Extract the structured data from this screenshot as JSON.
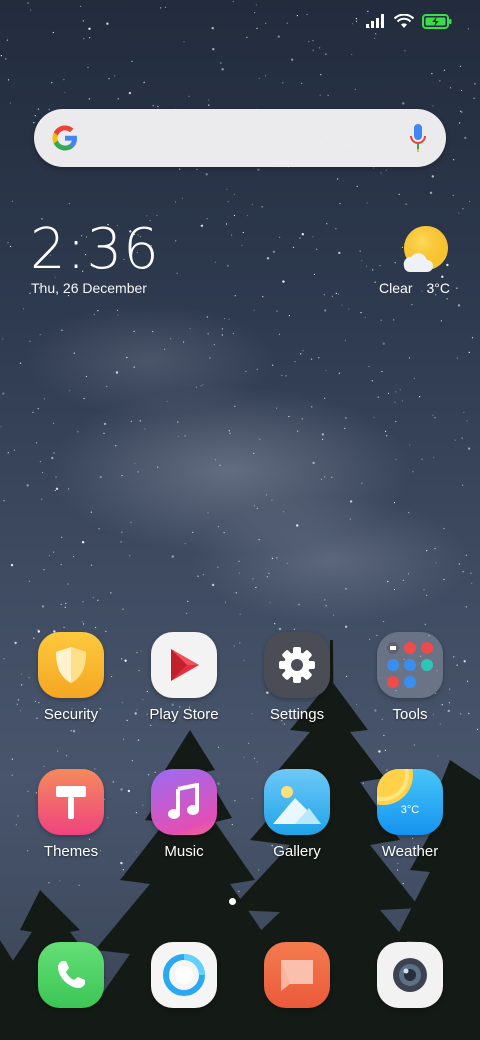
{
  "status_bar": {
    "icons": [
      "signal-icon",
      "wifi-icon",
      "battery-charging-icon"
    ],
    "battery_color": "#3ddc4a"
  },
  "search": {
    "logo": "google-logo-icon",
    "mic": "mic-icon"
  },
  "clock": {
    "time": "2:36",
    "date": "Thu, 26 December"
  },
  "weather_widget": {
    "condition": "Clear",
    "temperature": "3°C",
    "icon": "sun-cloud-icon"
  },
  "apps": [
    {
      "label": "Security",
      "icon": "shield-icon",
      "color": "#f7b52c"
    },
    {
      "label": "Play Store",
      "icon": "play-triangle-icon",
      "color": "#f2f2f2"
    },
    {
      "label": "Settings",
      "icon": "gear-icon",
      "color": "#4a4d55"
    },
    {
      "label": "Tools",
      "icon": "folder-icon",
      "color": "#7c8090"
    },
    {
      "label": "Themes",
      "icon": "paint-roller-icon",
      "color": "#f2577a"
    },
    {
      "label": "Music",
      "icon": "music-note-icon",
      "color": "#c255d6"
    },
    {
      "label": "Gallery",
      "icon": "mountain-icon",
      "color": "#3ac2f0"
    },
    {
      "label": "Weather",
      "icon": "weather-icon",
      "color": "#2cb7f5",
      "icon_text": "3°C"
    }
  ],
  "dock": [
    {
      "icon": "phone-icon",
      "color": "#4cd464"
    },
    {
      "icon": "browser-icon",
      "color": "#f5f5f5"
    },
    {
      "icon": "messages-icon",
      "color": "#f06a45"
    },
    {
      "icon": "camera-icon",
      "color": "#f0f0f0"
    }
  ],
  "page_indicator": {
    "pages": 1,
    "current": 1
  }
}
